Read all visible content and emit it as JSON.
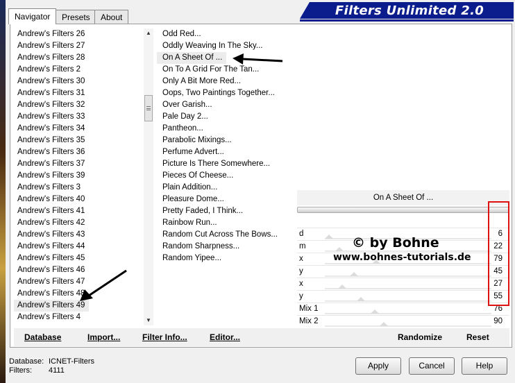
{
  "tabs": [
    {
      "label": "Navigator",
      "active": true
    },
    {
      "label": "Presets",
      "active": false
    },
    {
      "label": "About",
      "active": false
    }
  ],
  "app_title": "Filters Unlimited 2.0",
  "categories": [
    "Andrew's Filters 26",
    "Andrew's Filters 27",
    "Andrew's Filters 28",
    "Andrew's Filters 2",
    "Andrew's Filters 30",
    "Andrew's Filters 31",
    "Andrew's Filters 32",
    "Andrew's Filters 33",
    "Andrew's Filters 34",
    "Andrew's Filters 35",
    "Andrew's Filters 36",
    "Andrew's Filters 37",
    "Andrew's Filters 39",
    "Andrew's Filters 3",
    "Andrew's Filters 40",
    "Andrew's Filters 41",
    "Andrew's Filters 42",
    "Andrew's Filters 43",
    "Andrew's Filters 44",
    "Andrew's Filters 45",
    "Andrew's Filters 46",
    "Andrew's Filters 47",
    "Andrew's Filters 48",
    "Andrew's Filters 49",
    "Andrew's Filters 4"
  ],
  "selected_category": "Andrew's Filters 49",
  "filters": [
    "Odd Red...",
    "Oddly Weaving In The Sky...",
    "On A Sheet Of ...",
    "On To A Grid For The Tan...",
    "Only A Bit More Red...",
    "Oops, Two Paintings Together...",
    "Over Garish...",
    "Pale Day 2...",
    "Pantheon...",
    "Parabolic Mixings...",
    "Perfume Advert...",
    "Picture Is There Somewhere...",
    "Pieces Of Cheese...",
    "Plain Addition...",
    "Pleasure Dome...",
    "Pretty Faded, I Think...",
    "Rainbow Run...",
    "Random Cut Across The Bows...",
    "Random Sharpness...",
    "Random Yipee..."
  ],
  "selected_filter": "On A Sheet Of ...",
  "params": [
    {
      "label": "d",
      "value": "6"
    },
    {
      "label": "m",
      "value": "22"
    },
    {
      "label": "x",
      "value": "79"
    },
    {
      "label": "y",
      "value": "45"
    },
    {
      "label": "x",
      "value": "27"
    },
    {
      "label": "y",
      "value": "55"
    },
    {
      "label": "Mix 1",
      "value": "76"
    },
    {
      "label": "Mix 2",
      "value": "90"
    }
  ],
  "watermark": {
    "line1": "© by Bohne",
    "line2": "www.bohnes-tutorials.de"
  },
  "toolbar": {
    "database": "Database",
    "import": "Import...",
    "filter_info": "Filter Info...",
    "editor": "Editor...",
    "randomize": "Randomize",
    "reset": "Reset"
  },
  "status": {
    "database_label": "Database:",
    "database_value": "ICNET-Filters",
    "filters_label": "Filters:",
    "filters_value": "4111"
  },
  "buttons": {
    "apply": "Apply",
    "cancel": "Cancel",
    "help": "Help"
  }
}
